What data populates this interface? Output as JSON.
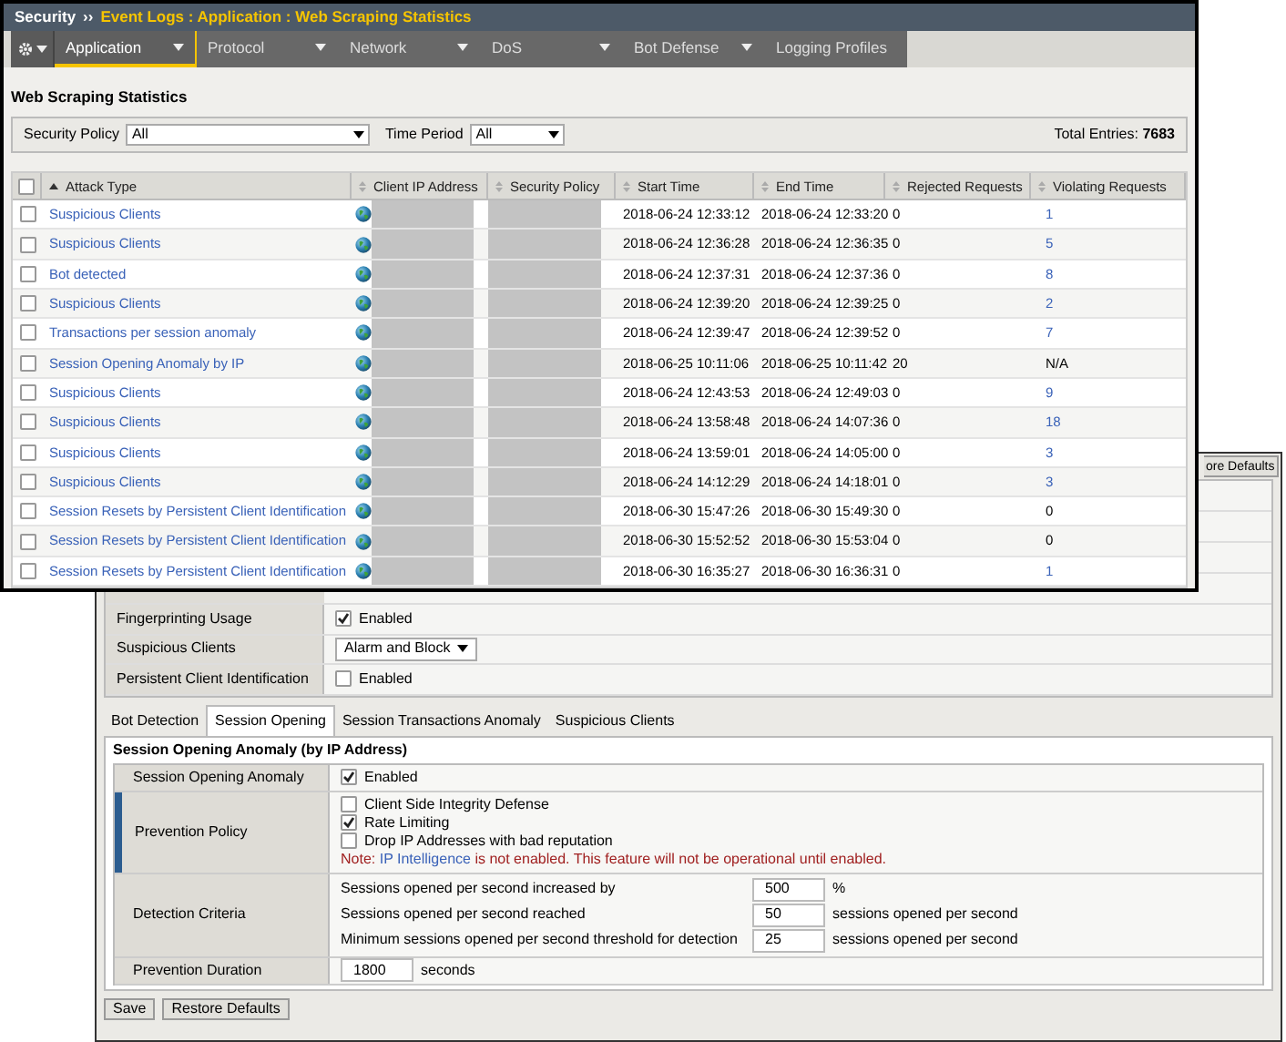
{
  "front_window": {
    "breadcrumb": {
      "root": "Security",
      "separator": "››",
      "path": "Event Logs : Application : Web Scraping Statistics"
    },
    "nav_tabs": [
      {
        "label": "Application",
        "selected": true,
        "has_menu": true
      },
      {
        "label": "Protocol",
        "selected": false,
        "has_menu": true
      },
      {
        "label": "Network",
        "selected": false,
        "has_menu": true
      },
      {
        "label": "DoS",
        "selected": false,
        "has_menu": true
      },
      {
        "label": "Bot Defense",
        "selected": false,
        "has_menu": true
      },
      {
        "label": "Logging Profiles",
        "selected": false,
        "has_menu": false
      }
    ],
    "title": "Web Scraping Statistics",
    "filters": [
      {
        "label": "Security Policy",
        "value": "All"
      },
      {
        "label": "Time Period",
        "value": "All"
      }
    ],
    "total": {
      "label": "Total Entries:",
      "value": "7683"
    },
    "table": {
      "header_checked": false,
      "columns": [
        {
          "label": "Attack Type",
          "sorted": true
        },
        {
          "label": "Client IP Address",
          "sorted": false
        },
        {
          "label": "Security Policy",
          "sorted": false
        },
        {
          "label": "Start Time",
          "sorted": false
        },
        {
          "label": "End Time",
          "sorted": false
        },
        {
          "label": "Rejected Requests",
          "sorted": false
        },
        {
          "label": "Violating Requests",
          "sorted": false
        }
      ],
      "rows": [
        {
          "checked": false,
          "attack_type": "Suspicious Clients",
          "start": "2018-06-24 12:33:12",
          "end": "2018-06-24 12:33:20",
          "rejected": "0",
          "violating": "1",
          "violating_link": true
        },
        {
          "checked": false,
          "attack_type": "Suspicious Clients",
          "start": "2018-06-24 12:36:28",
          "end": "2018-06-24 12:36:35",
          "rejected": "0",
          "violating": "5",
          "violating_link": true
        },
        {
          "checked": false,
          "attack_type": "Bot detected",
          "start": "2018-06-24 12:37:31",
          "end": "2018-06-24 12:37:36",
          "rejected": "0",
          "violating": "8",
          "violating_link": true
        },
        {
          "checked": false,
          "attack_type": "Suspicious Clients",
          "start": "2018-06-24 12:39:20",
          "end": "2018-06-24 12:39:25",
          "rejected": "0",
          "violating": "2",
          "violating_link": true
        },
        {
          "checked": false,
          "attack_type": "Transactions per session anomaly",
          "start": "2018-06-24 12:39:47",
          "end": "2018-06-24 12:39:52",
          "rejected": "0",
          "violating": "7",
          "violating_link": true
        },
        {
          "checked": false,
          "attack_type": "Session Opening Anomaly by IP",
          "start": "2018-06-25 10:11:06",
          "end": "2018-06-25 10:11:42",
          "rejected": "20",
          "violating": "N/A",
          "violating_link": false
        },
        {
          "checked": false,
          "attack_type": "Suspicious Clients",
          "start": "2018-06-24 12:43:53",
          "end": "2018-06-24 12:49:03",
          "rejected": "0",
          "violating": "9",
          "violating_link": true
        },
        {
          "checked": false,
          "attack_type": "Suspicious Clients",
          "start": "2018-06-24 13:58:48",
          "end": "2018-06-24 14:07:36",
          "rejected": "0",
          "violating": "18",
          "violating_link": true
        },
        {
          "checked": false,
          "attack_type": "Suspicious Clients",
          "start": "2018-06-24 13:59:01",
          "end": "2018-06-24 14:05:00",
          "rejected": "0",
          "violating": "3",
          "violating_link": true
        },
        {
          "checked": false,
          "attack_type": "Suspicious Clients",
          "start": "2018-06-24 14:12:29",
          "end": "2018-06-24 14:18:01",
          "rejected": "0",
          "violating": "3",
          "violating_link": true
        },
        {
          "checked": false,
          "attack_type": "Session Resets by Persistent Client Identification",
          "start": "2018-06-30 15:47:26",
          "end": "2018-06-30 15:49:30",
          "rejected": "0",
          "violating": "0",
          "violating_link": false
        },
        {
          "checked": false,
          "attack_type": "Session Resets by Persistent Client Identification",
          "start": "2018-06-30 15:52:52",
          "end": "2018-06-30 15:53:04",
          "rejected": "0",
          "violating": "0",
          "violating_link": false
        },
        {
          "checked": false,
          "attack_type": "Session Resets by Persistent Client Identification",
          "start": "2018-06-30 16:35:27",
          "end": "2018-06-30 16:36:31",
          "rejected": "0",
          "violating": "1",
          "violating_link": true
        }
      ]
    }
  },
  "back_window": {
    "top_button": "ore Defaults",
    "settings": [
      {
        "label": "Fingerprinting Usage",
        "kind": "checkbox",
        "checked": true,
        "text": "Enabled"
      },
      {
        "label": "Suspicious Clients",
        "kind": "select",
        "value": "Alarm and Block"
      },
      {
        "label": "Persistent Client Identification",
        "kind": "checkbox",
        "checked": false,
        "text": "Enabled"
      }
    ],
    "tabs": [
      {
        "label": "Bot Detection",
        "selected": false
      },
      {
        "label": "Session Opening",
        "selected": true
      },
      {
        "label": "Session Transactions Anomaly",
        "selected": false
      },
      {
        "label": "Suspicious Clients",
        "selected": false
      }
    ],
    "section": {
      "title": "Session Opening Anomaly (by IP Address)",
      "rows": [
        {
          "label": "Session Opening Anomaly",
          "kind": "checkbox",
          "highlighted": false,
          "checked": true,
          "text": "Enabled"
        },
        {
          "label": "Prevention Policy",
          "kind": "checklist",
          "highlighted": true,
          "options": [
            {
              "text": "Client Side Integrity Defense",
              "checked": false
            },
            {
              "text": "Rate Limiting",
              "checked": true
            },
            {
              "text": "Drop IP Addresses with bad reputation",
              "checked": false
            }
          ],
          "note": {
            "prefix": "Note:",
            "link": "IP Intelligence",
            "suffix": "is not enabled. This feature will not be operational until enabled."
          }
        },
        {
          "label": "Detection Criteria",
          "kind": "criteria",
          "highlighted": false,
          "lines": [
            {
              "text": "Sessions opened per second increased by",
              "value": "500",
              "unit": "%"
            },
            {
              "text": "Sessions opened per second reached",
              "value": "50",
              "unit": "sessions opened per second"
            },
            {
              "text": "Minimum sessions opened per second threshold for detection",
              "value": "25",
              "unit": "sessions opened per second"
            }
          ]
        },
        {
          "label": "Prevention Duration",
          "kind": "input",
          "highlighted": false,
          "value": "1800",
          "unit": "seconds"
        }
      ]
    },
    "buttons": [
      "Save",
      "Restore Defaults"
    ]
  }
}
